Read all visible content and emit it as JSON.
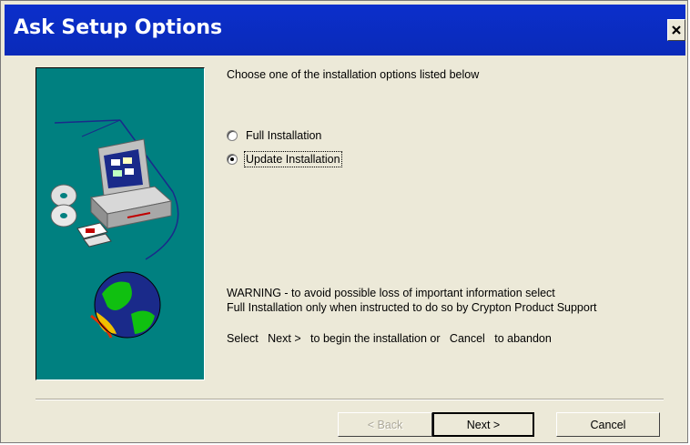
{
  "window": {
    "title": "Ask Setup Options",
    "close_label": "×"
  },
  "content": {
    "instruction": "Choose one of the installation options listed below",
    "options": [
      {
        "label": "Full Installation",
        "selected": false
      },
      {
        "label": "Update Installation",
        "selected": true
      }
    ],
    "warning_line1": "WARNING - to avoid possible loss of important information select",
    "warning_line2": "Full Installation  only when instructed to do so by Crypton Product Support",
    "select_hint": "Select   Next >   to begin the installation or   Cancel   to abandon"
  },
  "buttons": {
    "back": "< Back",
    "next": "Next >",
    "cancel": "Cancel"
  },
  "colors": {
    "title_bar": "#0b2ec0",
    "art_panel": "#008080",
    "dialog_bg": "#ece9d8"
  }
}
